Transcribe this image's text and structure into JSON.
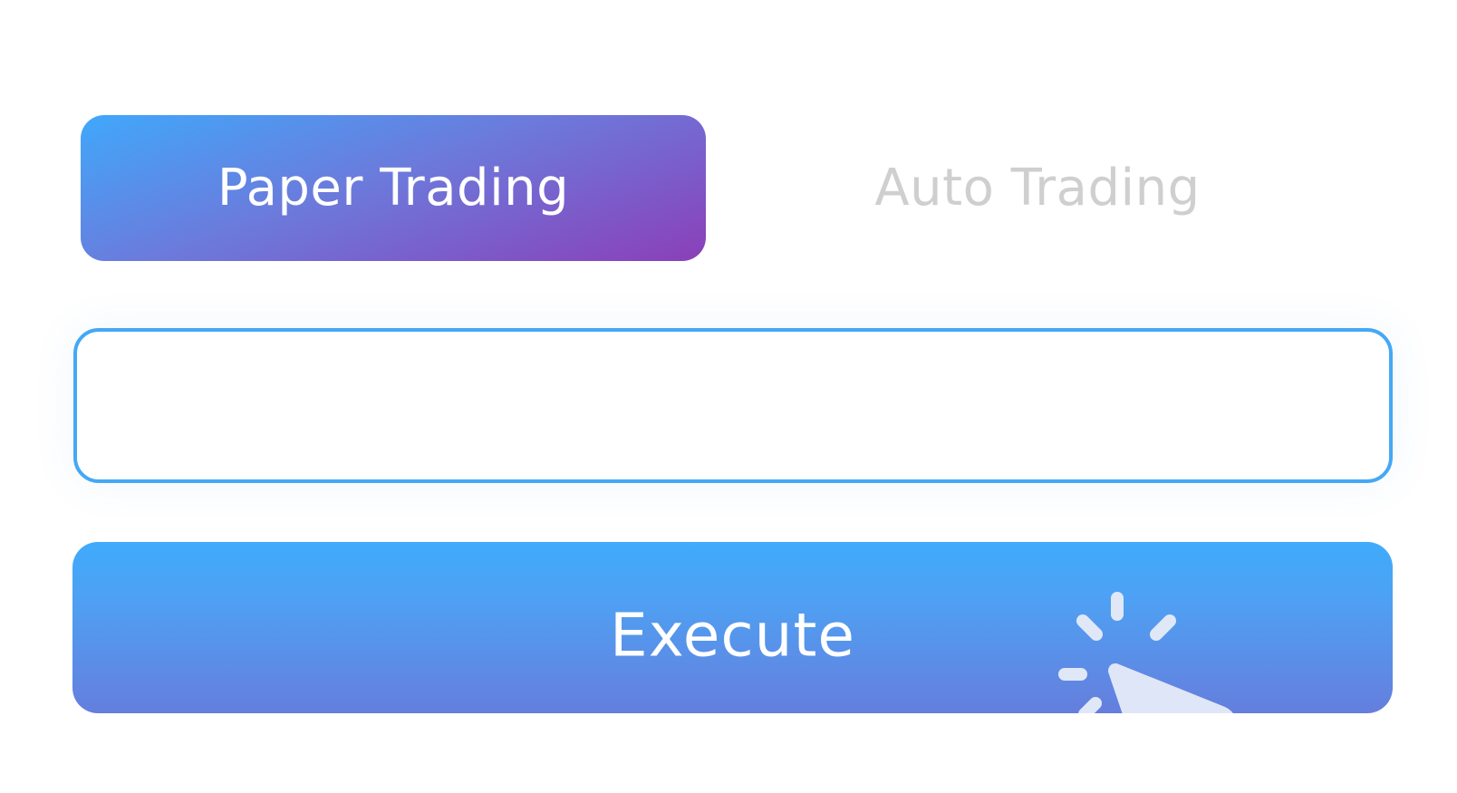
{
  "tabs": [
    {
      "label": "Paper Trading",
      "active": true
    },
    {
      "label": "Auto Trading",
      "active": false
    }
  ],
  "order_input": {
    "value": "",
    "placeholder": ""
  },
  "execute_button": {
    "label": "Execute",
    "icon": "click-cursor-icon"
  },
  "colors": {
    "accent_blue": "#44a8f5",
    "accent_purple": "#8b3fb8",
    "inactive_text": "#cfcfcf"
  }
}
